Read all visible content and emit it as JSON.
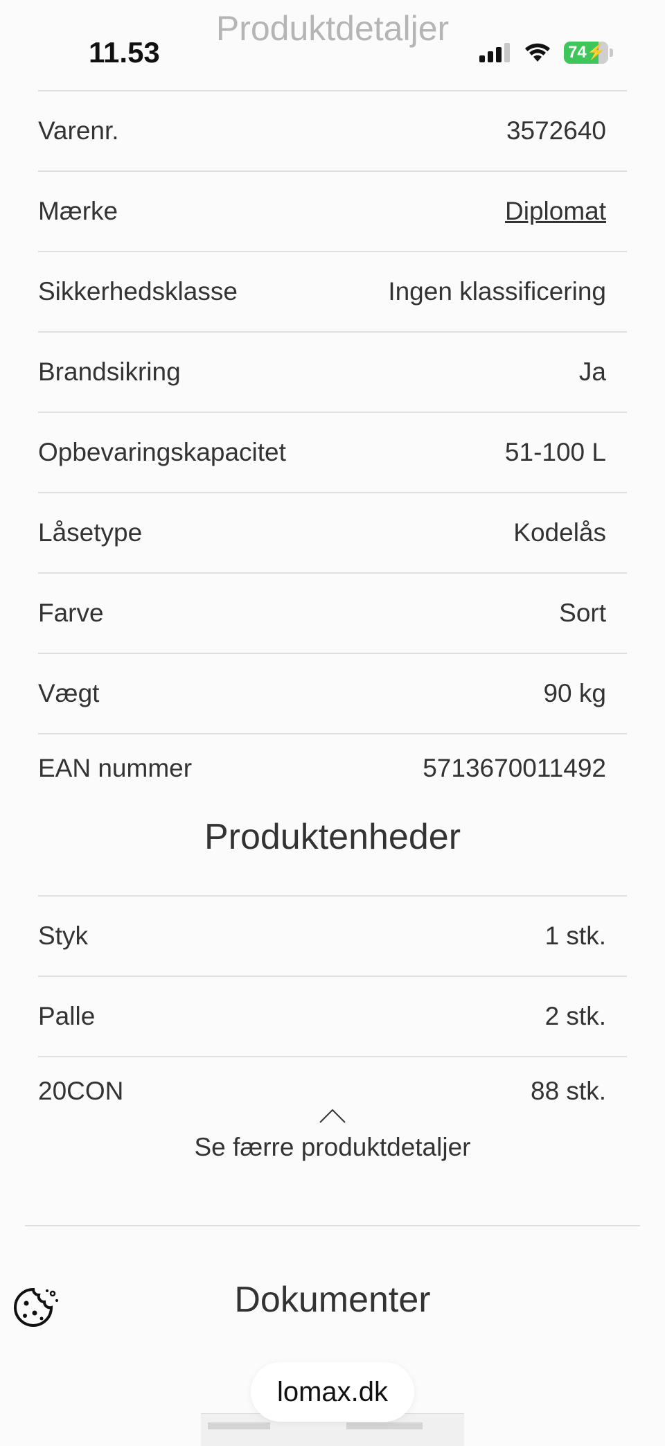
{
  "status_bar": {
    "time": "11.53",
    "battery": "74",
    "page_title_faded": "Produktdetaljer"
  },
  "details": [
    {
      "label": "Varenr.",
      "value": "3572640",
      "link": false
    },
    {
      "label": "Mærke",
      "value": "Diplomat",
      "link": true
    },
    {
      "label": "Sikkerhedsklasse",
      "value": "Ingen klassificering",
      "link": false
    },
    {
      "label": "Brandsikring",
      "value": "Ja",
      "link": false
    },
    {
      "label": "Opbevaringskapacitet",
      "value": "51-100 L",
      "link": false
    },
    {
      "label": "Låsetype",
      "value": "Kodelås",
      "link": false
    },
    {
      "label": "Farve",
      "value": "Sort",
      "link": false
    },
    {
      "label": "Vægt",
      "value": "90 kg",
      "link": false
    },
    {
      "label": "EAN nummer",
      "value": "5713670011492",
      "link": false
    }
  ],
  "units_title": "Produktenheder",
  "units": [
    {
      "label": "Styk",
      "value": "1 stk."
    },
    {
      "label": "Palle",
      "value": "2 stk."
    },
    {
      "label": "20CON",
      "value": "88 stk."
    }
  ],
  "collapse_label": "Se færre produktdetaljer",
  "documents_title": "Dokumenter",
  "url": "lomax.dk",
  "icons": {
    "cookie": "cookie-icon",
    "collapse": "chevron-up-icon",
    "signal": "signal-icon",
    "wifi": "wifi-icon",
    "battery": "battery-icon"
  },
  "colors": {
    "battery_green": "#3ec65a",
    "divider": "#dedfe4",
    "text": "#333333"
  }
}
